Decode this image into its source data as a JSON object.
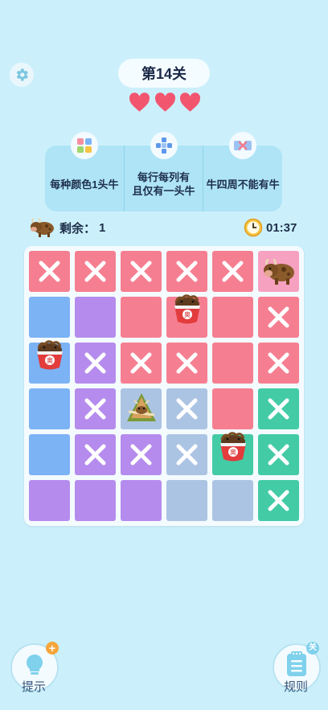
{
  "header": {
    "level_label": "第14关",
    "lives": 3
  },
  "rules": [
    {
      "text": "每种颜色1头牛",
      "icon": "color-grid-icon"
    },
    {
      "text": "每行每列有\n且仅有一头牛",
      "icon": "cross-grid-icon"
    },
    {
      "text": "牛四周不能有牛",
      "icon": "no-adjacent-icon"
    }
  ],
  "status": {
    "remaining_label": "剩余：",
    "remaining_count": "1",
    "timer": "01:37"
  },
  "board": {
    "size": 6,
    "colors": {
      "red": "#f57f91",
      "blue": "#7cb3f5",
      "purple": "#b58ced",
      "green": "#43cba6",
      "pink": "#f6a1c0",
      "lightblue": "#acc4e3"
    },
    "rows": [
      [
        "red",
        "red",
        "red",
        "red",
        "red",
        "pink"
      ],
      [
        "blue",
        "purple",
        "red",
        "red",
        "red",
        "red"
      ],
      [
        "blue",
        "purple",
        "red",
        "red",
        "red",
        "red"
      ],
      [
        "blue",
        "purple",
        "lightblue",
        "lightblue",
        "red",
        "green"
      ],
      [
        "blue",
        "purple",
        "purple",
        "lightblue",
        "green",
        "green"
      ],
      [
        "purple",
        "purple",
        "purple",
        "lightblue",
        "lightblue",
        "green"
      ]
    ],
    "marks": [
      [
        1,
        1,
        1,
        1,
        1,
        0
      ],
      [
        0,
        0,
        0,
        0,
        0,
        1
      ],
      [
        0,
        1,
        1,
        1,
        0,
        1
      ],
      [
        0,
        1,
        0,
        1,
        0,
        1
      ],
      [
        0,
        1,
        1,
        1,
        0,
        1
      ],
      [
        0,
        0,
        0,
        0,
        0,
        1
      ]
    ],
    "pieces": [
      {
        "row": 0,
        "col": 5,
        "kind": "cow"
      },
      {
        "row": 1,
        "col": 3,
        "kind": "noodle"
      },
      {
        "row": 2,
        "col": 0,
        "kind": "noodle"
      },
      {
        "row": 3,
        "col": 2,
        "kind": "zongzi"
      },
      {
        "row": 4,
        "col": 4,
        "kind": "noodle"
      }
    ]
  },
  "bottom": {
    "hint_label": "提示",
    "rules_label": "规则",
    "rules_badge": "关"
  }
}
